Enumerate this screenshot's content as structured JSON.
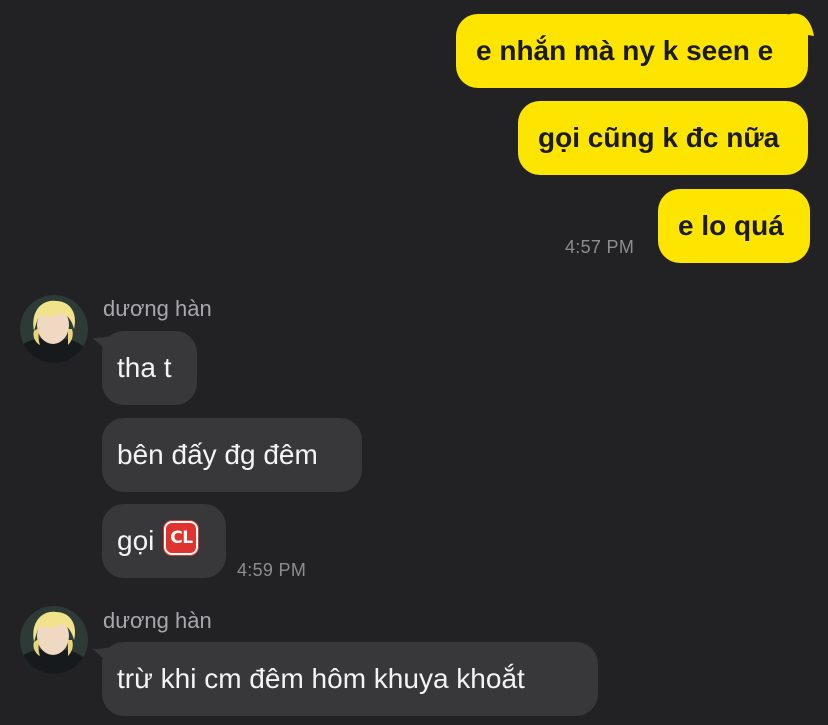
{
  "colors": {
    "background": "#222224",
    "outgoing_bubble": "#fee500",
    "incoming_bubble": "#38383b",
    "timestamp": "#8d8d90",
    "sender_name": "#a8a8ac",
    "cl_badge": "#e1332d"
  },
  "outgoing": {
    "messages": [
      {
        "text": "e nhắn mà ny k seen e"
      },
      {
        "text": "gọi cũng k đc nữa"
      },
      {
        "text": "e lo quá"
      }
    ],
    "time": "4:57 PM"
  },
  "groups": [
    {
      "sender": "dương hàn",
      "avatar_icon": "avatar-photo-icon",
      "messages": [
        {
          "text": "tha t"
        },
        {
          "text": "bên đấy đg đêm"
        },
        {
          "text": "gọi",
          "emoji_icon": "cl-button-icon",
          "emoji_text": "CL"
        }
      ],
      "time": "4:59 PM"
    },
    {
      "sender": "dương hàn",
      "avatar_icon": "avatar-photo-icon",
      "messages": [
        {
          "text": "trừ khi cm đêm hôm khuya khoắt"
        }
      ]
    }
  ]
}
